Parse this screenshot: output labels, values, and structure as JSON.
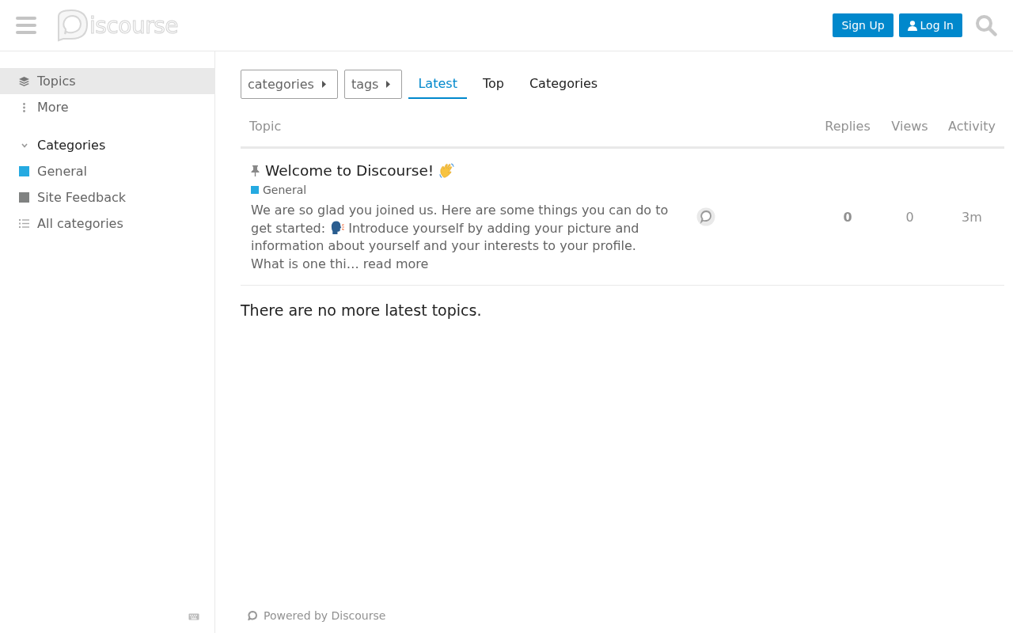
{
  "header": {
    "logo_text": "iscourse",
    "buttons": [
      {
        "label": "Sign Up",
        "kind": "signup"
      },
      {
        "label": "Log In",
        "kind": "login"
      }
    ]
  },
  "sidebar": {
    "items": [
      {
        "label": "Topics",
        "kind": "topics",
        "selected": true
      },
      {
        "label": "More",
        "kind": "more",
        "selected": false
      }
    ],
    "sections": [
      {
        "title": "Categories",
        "expanded": true,
        "items": [
          {
            "label": "General",
            "kind": "category",
            "color": "#25aae1"
          },
          {
            "label": "Site Feedback",
            "kind": "category",
            "color": "#808281"
          },
          {
            "label": "All categories",
            "kind": "all"
          }
        ]
      }
    ]
  },
  "nav": {
    "dropdowns": [
      "categories",
      "tags"
    ],
    "tabs": [
      {
        "label": "Latest",
        "selected": true
      },
      {
        "label": "Top",
        "selected": false
      },
      {
        "label": "Categories",
        "selected": false
      }
    ]
  },
  "table": {
    "columns": [
      "Topic",
      "Replies",
      "Views",
      "Activity"
    ],
    "rows": [
      {
        "pinned": true,
        "title": "Welcome to Discourse!",
        "category": {
          "label": "General",
          "color": "#25aae1"
        },
        "excerpt": {
          "before": "We are so glad you joined us. Here are some things you can do to get started:",
          "after": "Introduce yourself by adding your picture and information about yourself and your interests to your profile. What is one thi…",
          "link": "read more"
        },
        "replies": "0",
        "views": "0",
        "activity": "3m"
      }
    ]
  },
  "list_footer": "There are no more latest topics.",
  "footer": {
    "powered_by": "Powered by Discourse"
  }
}
